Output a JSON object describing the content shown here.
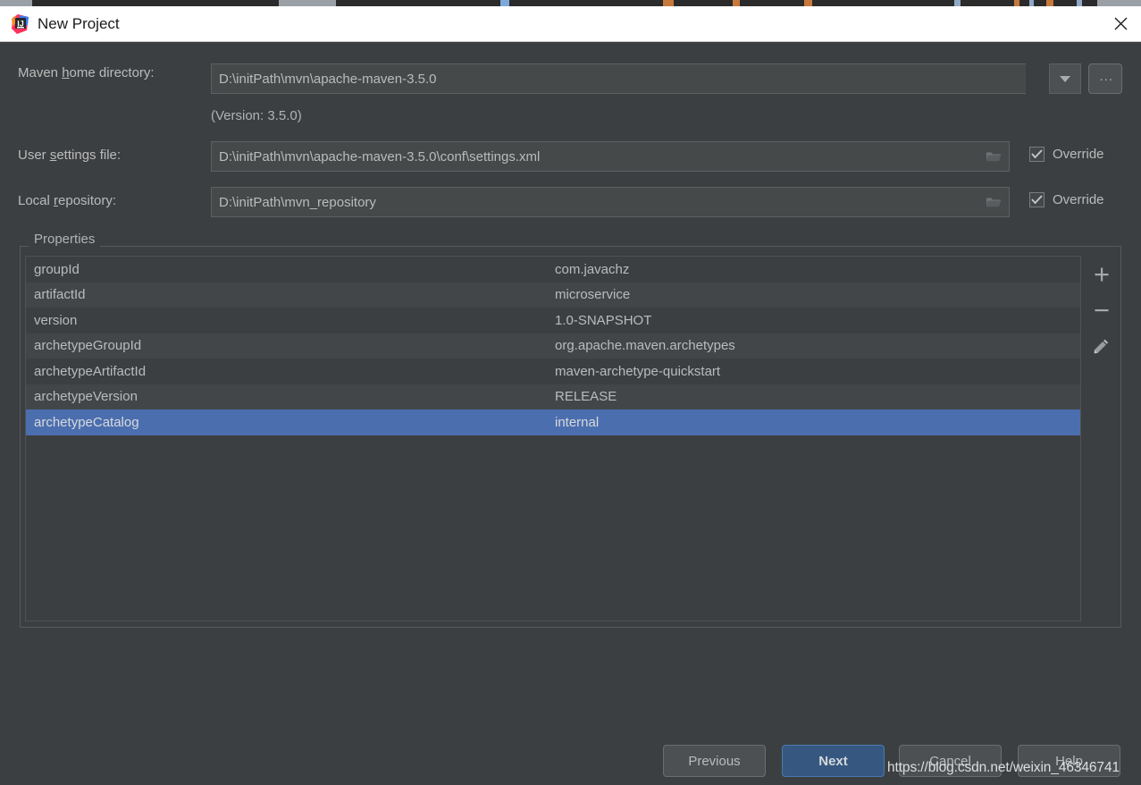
{
  "window": {
    "title": "New Project",
    "logo_icon": "intellij-idea-logo",
    "close_icon": "close-icon"
  },
  "form": {
    "maven_home": {
      "label_prefix": "Maven ",
      "label_mnemonic": "h",
      "label_suffix": "ome directory:",
      "value": "D:\\initPath\\mvn\\apache-maven-3.5.0",
      "dropdown_icon": "chevron-down-icon",
      "browse_label": "...",
      "version_note": "(Version: 3.5.0)"
    },
    "user_settings": {
      "label_prefix": "User ",
      "label_mnemonic": "s",
      "label_suffix": "ettings file:",
      "value": "D:\\initPath\\mvn\\apache-maven-3.5.0\\conf\\settings.xml",
      "folder_icon": "folder-icon",
      "override_label": "Override",
      "override_checked": true
    },
    "local_repository": {
      "label_prefix": "Local ",
      "label_mnemonic": "r",
      "label_suffix": "epository:",
      "value": "D:\\initPath\\mvn_repository",
      "folder_icon": "folder-icon",
      "override_label": "Override",
      "override_checked": true
    }
  },
  "properties": {
    "legend": "Properties",
    "rows": [
      {
        "key": "groupId",
        "value": "com.javachz",
        "selected": false
      },
      {
        "key": "artifactId",
        "value": "microservice",
        "selected": false
      },
      {
        "key": "version",
        "value": "1.0-SNAPSHOT",
        "selected": false
      },
      {
        "key": "archetypeGroupId",
        "value": "org.apache.maven.archetypes",
        "selected": false
      },
      {
        "key": "archetypeArtifactId",
        "value": "maven-archetype-quickstart",
        "selected": false
      },
      {
        "key": "archetypeVersion",
        "value": "RELEASE",
        "selected": false
      },
      {
        "key": "archetypeCatalog",
        "value": "internal",
        "selected": true
      }
    ],
    "toolbar": {
      "add_icon": "plus-icon",
      "remove_icon": "minus-icon",
      "edit_icon": "pencil-icon"
    }
  },
  "footer": {
    "previous_label": "Previous",
    "next_label": "Next",
    "cancel_label": "Cancel",
    "help_label": "Help"
  },
  "watermark": {
    "text": "https://blog.csdn.net/weixin_46346741"
  },
  "colors": {
    "dialog_background": "#3c3f41",
    "titlebar_background": "#ffffff",
    "field_background": "#45494a",
    "selection_blue": "#4b6eaf",
    "primary_button": "#365880",
    "text_primary": "#b9bcbd"
  }
}
